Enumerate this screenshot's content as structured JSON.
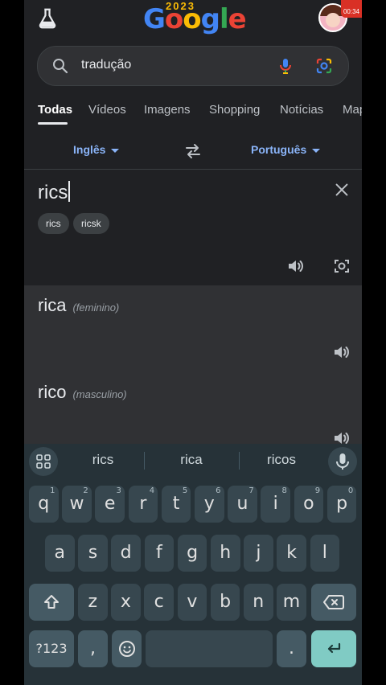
{
  "status": {
    "recording_time": "00:34"
  },
  "header": {
    "logo_text": "Google",
    "doodle_year": "2023"
  },
  "search": {
    "query": "tradução"
  },
  "tabs": [
    {
      "label": "Todas",
      "active": true
    },
    {
      "label": "Vídeos"
    },
    {
      "label": "Imagens"
    },
    {
      "label": "Shopping"
    },
    {
      "label": "Notícias"
    },
    {
      "label": "Map"
    }
  ],
  "translate": {
    "source_lang": "Inglês",
    "target_lang": "Português",
    "source_text": "rics",
    "chips": [
      "rics",
      "ricsk"
    ],
    "results": [
      {
        "word": "rica",
        "gender": "(feminino)"
      },
      {
        "word": "rico",
        "gender": "(masculino)"
      }
    ]
  },
  "keyboard": {
    "suggestions": [
      "rics",
      "rica",
      "ricos"
    ],
    "row1": [
      {
        "k": "q",
        "h": "1"
      },
      {
        "k": "w",
        "h": "2"
      },
      {
        "k": "e",
        "h": "3"
      },
      {
        "k": "r",
        "h": "4"
      },
      {
        "k": "t",
        "h": "5"
      },
      {
        "k": "y",
        "h": "6"
      },
      {
        "k": "u",
        "h": "7"
      },
      {
        "k": "i",
        "h": "8"
      },
      {
        "k": "o",
        "h": "9"
      },
      {
        "k": "p",
        "h": "0"
      }
    ],
    "row2": [
      "a",
      "s",
      "d",
      "f",
      "g",
      "h",
      "j",
      "k",
      "l"
    ],
    "row3": [
      "z",
      "x",
      "c",
      "v",
      "b",
      "n",
      "m"
    ],
    "symbols_label": "?123",
    "comma_label": ",",
    "period_label": "."
  },
  "colors": {
    "accent": "#8ab4f8",
    "enter_key": "#80cbc4",
    "keyboard_bg": "#263238"
  }
}
